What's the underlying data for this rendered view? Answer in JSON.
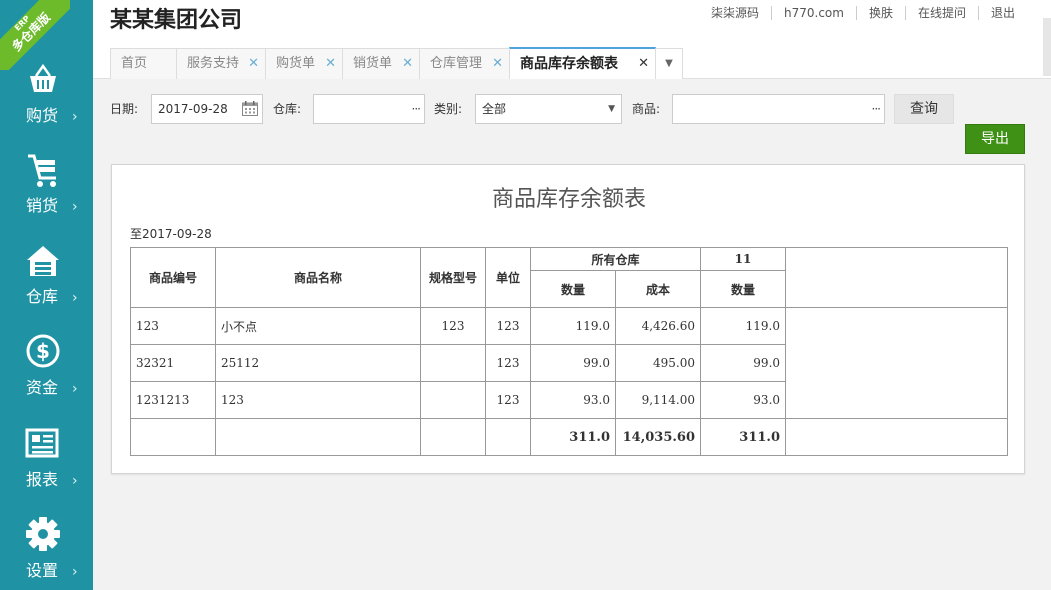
{
  "app": {
    "company": "某某集团公司",
    "ribbon_erp": "ERP",
    "ribbon_label": "多仓库版"
  },
  "top_links": [
    "柒柒源码",
    "h770.com",
    "换肤",
    "在线提问",
    "退出"
  ],
  "sidebar": {
    "items": [
      {
        "label": "购货",
        "icon": "basket-icon"
      },
      {
        "label": "销货",
        "icon": "cart-icon"
      },
      {
        "label": "仓库",
        "icon": "warehouse-icon"
      },
      {
        "label": "资金",
        "icon": "dollar-icon"
      },
      {
        "label": "报表",
        "icon": "report-icon"
      },
      {
        "label": "设置",
        "icon": "gear-icon"
      }
    ],
    "chevron": "›"
  },
  "tabs": [
    {
      "label": "首页",
      "closable": false,
      "active": false
    },
    {
      "label": "服务支持",
      "closable": true,
      "active": false
    },
    {
      "label": "购货单",
      "closable": true,
      "active": false
    },
    {
      "label": "销货单",
      "closable": true,
      "active": false
    },
    {
      "label": "仓库管理",
      "closable": true,
      "active": false
    },
    {
      "label": "商品库存余额表",
      "closable": true,
      "active": true
    }
  ],
  "filters": {
    "date_label": "日期:",
    "date_value": "2017-09-28",
    "warehouse_label": "仓库:",
    "warehouse_value": "",
    "category_label": "类别:",
    "category_value": "全部",
    "product_label": "商品:",
    "product_value": "",
    "ellipsis": "···"
  },
  "buttons": {
    "query": "查询",
    "export": "导出"
  },
  "report": {
    "title": "商品库存余额表",
    "date_line": "至2017-09-28",
    "headers": {
      "code": "商品编号",
      "name": "商品名称",
      "spec": "规格型号",
      "unit": "单位",
      "group_all": "所有仓库",
      "group_11": "11",
      "qty": "数量",
      "cost": "成本",
      "qty2": "数量"
    },
    "rows": [
      {
        "code": "123",
        "name": "小不点",
        "spec": "123",
        "unit": "123",
        "qty": "119.0",
        "cost": "4,426.60",
        "qty2": "119.0"
      },
      {
        "code": "32321",
        "name": "25112",
        "spec": "",
        "unit": "123",
        "qty": "99.0",
        "cost": "495.00",
        "qty2": "99.0"
      },
      {
        "code": "1231213",
        "name": "123",
        "spec": "",
        "unit": "123",
        "qty": "93.0",
        "cost": "9,114.00",
        "qty2": "93.0"
      }
    ],
    "totals": {
      "qty": "311.0",
      "cost": "14,035.60",
      "qty2": "311.0"
    }
  },
  "colors": {
    "sidebar": "#1f93a4",
    "ribbon": "#6dbb2b",
    "export": "#3e9114",
    "tab_accent": "#4fa3dc"
  }
}
